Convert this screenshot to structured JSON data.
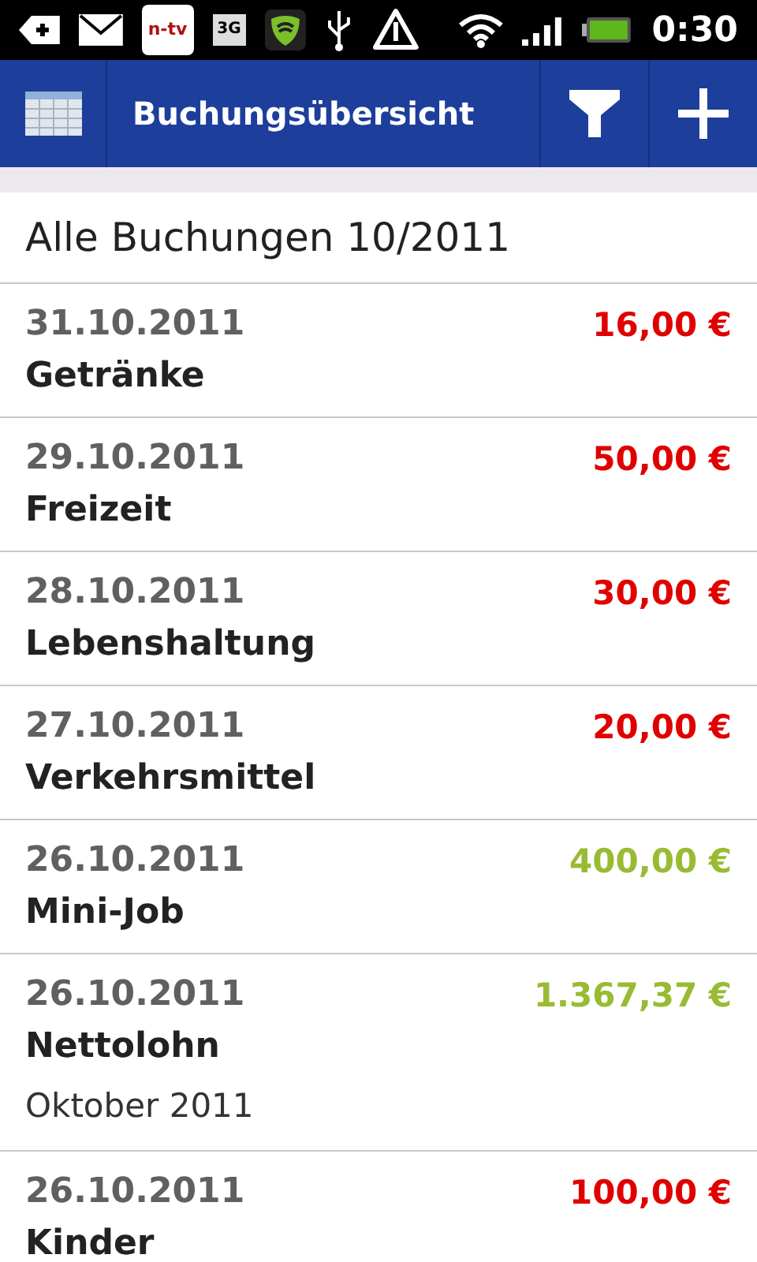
{
  "status_bar": {
    "news_badge": "n-tv",
    "network_type": "3G",
    "time": "0:30"
  },
  "action_bar": {
    "title": "Buchungsübersicht"
  },
  "list": {
    "heading": "Alle Buchungen 10/2011",
    "rows": [
      {
        "date": "31.10.2011",
        "category": "Getränke",
        "amount": "16,00 €",
        "kind": "expense"
      },
      {
        "date": "29.10.2011",
        "category": "Freizeit",
        "amount": "50,00 €",
        "kind": "expense"
      },
      {
        "date": "28.10.2011",
        "category": "Lebenshaltung",
        "amount": "30,00 €",
        "kind": "expense"
      },
      {
        "date": "27.10.2011",
        "category": "Verkehrsmittel",
        "amount": "20,00 €",
        "kind": "expense"
      },
      {
        "date": "26.10.2011",
        "category": "Mini-Job",
        "amount": "400,00 €",
        "kind": "income"
      },
      {
        "date": "26.10.2011",
        "category": "Nettolohn",
        "note": "Oktober 2011",
        "amount": "1.367,37 €",
        "kind": "income"
      },
      {
        "date": "26.10.2011",
        "category": "Kinder",
        "amount": "100,00 €",
        "kind": "expense"
      }
    ]
  }
}
